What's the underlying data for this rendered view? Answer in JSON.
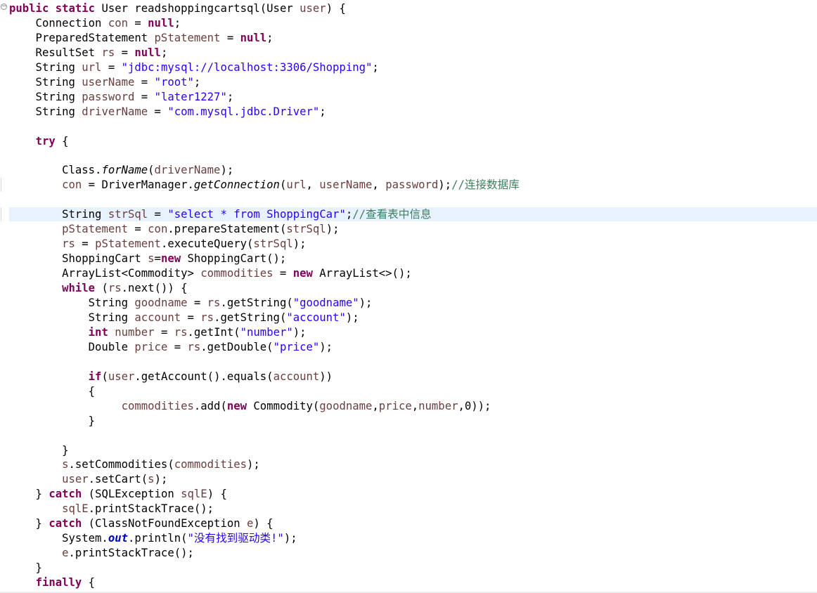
{
  "editor": {
    "language": "java",
    "lines": [
      [
        [
          "kw",
          "public"
        ],
        [
          "p",
          " "
        ],
        [
          "kw",
          "static"
        ],
        [
          "p",
          " User readshoppingcartsql(User "
        ],
        [
          "var",
          "user"
        ],
        [
          "p",
          ") {"
        ]
      ],
      [
        [
          "p",
          "    Connection "
        ],
        [
          "var",
          "con"
        ],
        [
          "p",
          " = "
        ],
        [
          "kw",
          "null"
        ],
        [
          "p",
          ";"
        ]
      ],
      [
        [
          "p",
          "    PreparedStatement "
        ],
        [
          "var",
          "pStatement"
        ],
        [
          "p",
          " = "
        ],
        [
          "kw",
          "null"
        ],
        [
          "p",
          ";"
        ]
      ],
      [
        [
          "p",
          "    ResultSet "
        ],
        [
          "var",
          "rs"
        ],
        [
          "p",
          " = "
        ],
        [
          "kw",
          "null"
        ],
        [
          "p",
          ";"
        ]
      ],
      [
        [
          "p",
          "    String "
        ],
        [
          "var",
          "url"
        ],
        [
          "p",
          " = "
        ],
        [
          "str",
          "\"jdbc:mysql://localhost:3306/Shopping\""
        ],
        [
          "p",
          ";"
        ]
      ],
      [
        [
          "p",
          "    String "
        ],
        [
          "var",
          "userName"
        ],
        [
          "p",
          " = "
        ],
        [
          "str",
          "\"root\""
        ],
        [
          "p",
          ";"
        ]
      ],
      [
        [
          "p",
          "    String "
        ],
        [
          "var",
          "password"
        ],
        [
          "p",
          " = "
        ],
        [
          "str",
          "\"later1227\""
        ],
        [
          "p",
          ";"
        ]
      ],
      [
        [
          "p",
          "    String "
        ],
        [
          "var",
          "driverName"
        ],
        [
          "p",
          " = "
        ],
        [
          "str",
          "\"com.mysql.jdbc.Driver\""
        ],
        [
          "p",
          ";"
        ]
      ],
      [],
      [
        [
          "p",
          "    "
        ],
        [
          "kw",
          "try"
        ],
        [
          "p",
          " {"
        ]
      ],
      [],
      [
        [
          "p",
          "        Class."
        ],
        [
          "it",
          "forName"
        ],
        [
          "p",
          "("
        ],
        [
          "var",
          "driverName"
        ],
        [
          "p",
          ");"
        ]
      ],
      [
        [
          "p",
          "        "
        ],
        [
          "var",
          "con"
        ],
        [
          "p",
          " = DriverManager."
        ],
        [
          "it",
          "getConnection"
        ],
        [
          "p",
          "("
        ],
        [
          "var",
          "url"
        ],
        [
          "p",
          ", "
        ],
        [
          "var",
          "userName"
        ],
        [
          "p",
          ", "
        ],
        [
          "var",
          "password"
        ],
        [
          "p",
          ");"
        ],
        [
          "cmt",
          "//连接数据库"
        ]
      ],
      [],
      [
        [
          "p",
          "        String "
        ],
        [
          "var",
          "strSql"
        ],
        [
          "p",
          " = "
        ],
        [
          "str",
          "\"select * from ShoppingCar\""
        ],
        [
          "p",
          ";"
        ],
        [
          "cmt",
          "//查看表中信息"
        ]
      ],
      [
        [
          "p",
          "        "
        ],
        [
          "var",
          "pStatement"
        ],
        [
          "p",
          " = "
        ],
        [
          "var",
          "con"
        ],
        [
          "p",
          ".prepareStatement("
        ],
        [
          "var",
          "strSql"
        ],
        [
          "p",
          ");"
        ]
      ],
      [
        [
          "p",
          "        "
        ],
        [
          "var",
          "rs"
        ],
        [
          "p",
          " = "
        ],
        [
          "var",
          "pStatement"
        ],
        [
          "p",
          ".executeQuery("
        ],
        [
          "var",
          "strSql"
        ],
        [
          "p",
          ");"
        ]
      ],
      [
        [
          "p",
          "        ShoppingCart "
        ],
        [
          "var",
          "s"
        ],
        [
          "p",
          "="
        ],
        [
          "kw",
          "new"
        ],
        [
          "p",
          " ShoppingCart();"
        ]
      ],
      [
        [
          "p",
          "        ArrayList<Commodity> "
        ],
        [
          "var",
          "commodities"
        ],
        [
          "p",
          " = "
        ],
        [
          "kw",
          "new"
        ],
        [
          "p",
          " ArrayList<>();"
        ]
      ],
      [
        [
          "p",
          "        "
        ],
        [
          "kw",
          "while"
        ],
        [
          "p",
          " ("
        ],
        [
          "var",
          "rs"
        ],
        [
          "p",
          ".next()) {"
        ]
      ],
      [
        [
          "p",
          "            String "
        ],
        [
          "var",
          "goodname"
        ],
        [
          "p",
          " = "
        ],
        [
          "var",
          "rs"
        ],
        [
          "p",
          ".getString("
        ],
        [
          "str",
          "\"goodname\""
        ],
        [
          "p",
          ");"
        ]
      ],
      [
        [
          "p",
          "            String "
        ],
        [
          "var",
          "account"
        ],
        [
          "p",
          " = "
        ],
        [
          "var",
          "rs"
        ],
        [
          "p",
          ".getString("
        ],
        [
          "str",
          "\"account\""
        ],
        [
          "p",
          ");"
        ]
      ],
      [
        [
          "p",
          "            "
        ],
        [
          "kw",
          "int"
        ],
        [
          "p",
          " "
        ],
        [
          "var",
          "number"
        ],
        [
          "p",
          " = "
        ],
        [
          "var",
          "rs"
        ],
        [
          "p",
          ".getInt("
        ],
        [
          "str",
          "\"number\""
        ],
        [
          "p",
          ");"
        ]
      ],
      [
        [
          "p",
          "            Double "
        ],
        [
          "var",
          "price"
        ],
        [
          "p",
          " = "
        ],
        [
          "var",
          "rs"
        ],
        [
          "p",
          ".getDouble("
        ],
        [
          "str",
          "\"price\""
        ],
        [
          "p",
          ");"
        ]
      ],
      [],
      [
        [
          "p",
          "            "
        ],
        [
          "kw",
          "if"
        ],
        [
          "p",
          "("
        ],
        [
          "var",
          "user"
        ],
        [
          "p",
          ".getAccount().equals("
        ],
        [
          "var",
          "account"
        ],
        [
          "p",
          "))"
        ]
      ],
      [
        [
          "p",
          "            {"
        ]
      ],
      [
        [
          "p",
          "                 "
        ],
        [
          "var",
          "commodities"
        ],
        [
          "p",
          ".add("
        ],
        [
          "kw",
          "new"
        ],
        [
          "p",
          " Commodity("
        ],
        [
          "var",
          "goodname"
        ],
        [
          "p",
          ","
        ],
        [
          "var",
          "price"
        ],
        [
          "p",
          ","
        ],
        [
          "var",
          "number"
        ],
        [
          "p",
          ",0));"
        ]
      ],
      [
        [
          "p",
          "            }"
        ]
      ],
      [],
      [
        [
          "p",
          "        }"
        ]
      ],
      [
        [
          "p",
          "        "
        ],
        [
          "var",
          "s"
        ],
        [
          "p",
          ".setCommodities("
        ],
        [
          "var",
          "commodities"
        ],
        [
          "p",
          ");"
        ]
      ],
      [
        [
          "p",
          "        "
        ],
        [
          "var",
          "user"
        ],
        [
          "p",
          ".setCart("
        ],
        [
          "var",
          "s"
        ],
        [
          "p",
          ");"
        ]
      ],
      [
        [
          "p",
          "    } "
        ],
        [
          "kw",
          "catch"
        ],
        [
          "p",
          " (SQLException "
        ],
        [
          "var",
          "sqlE"
        ],
        [
          "p",
          ") {"
        ]
      ],
      [
        [
          "p",
          "        "
        ],
        [
          "var",
          "sqlE"
        ],
        [
          "p",
          ".printStackTrace();"
        ]
      ],
      [
        [
          "p",
          "    } "
        ],
        [
          "kw",
          "catch"
        ],
        [
          "p",
          " (ClassNotFoundException "
        ],
        [
          "var",
          "e"
        ],
        [
          "p",
          ") {"
        ]
      ],
      [
        [
          "p",
          "        System."
        ],
        [
          "fld",
          "out"
        ],
        [
          "p",
          ".println("
        ],
        [
          "str",
          "\"没有找到驱动类!\""
        ],
        [
          "p",
          ");"
        ]
      ],
      [
        [
          "p",
          "        "
        ],
        [
          "var",
          "e"
        ],
        [
          "p",
          ".printStackTrace();"
        ]
      ],
      [
        [
          "p",
          "    }"
        ]
      ],
      [
        [
          "p",
          "    "
        ],
        [
          "kw",
          "finally"
        ],
        [
          "p",
          " {"
        ]
      ]
    ]
  }
}
